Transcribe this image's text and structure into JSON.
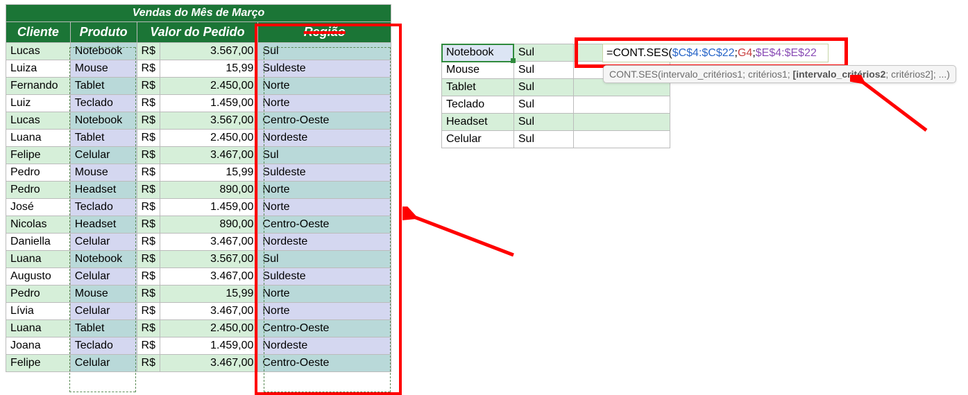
{
  "title": "Vendas do Mês de Março",
  "headers": {
    "cliente": "Cliente",
    "produto": "Produto",
    "valor": "Valor do Pedido",
    "regiao": "Região"
  },
  "currency": "R$",
  "rows": [
    {
      "cliente": "Lucas",
      "produto": "Notebook",
      "valor": "3.567,00",
      "regiao": "Sul"
    },
    {
      "cliente": "Luiza",
      "produto": "Mouse",
      "valor": "15,99",
      "regiao": "Suldeste"
    },
    {
      "cliente": "Fernando",
      "produto": "Tablet",
      "valor": "2.450,00",
      "regiao": "Norte"
    },
    {
      "cliente": "Luiz",
      "produto": "Teclado",
      "valor": "1.459,00",
      "regiao": "Norte"
    },
    {
      "cliente": "Lucas",
      "produto": "Notebook",
      "valor": "3.567,00",
      "regiao": "Centro-Oeste"
    },
    {
      "cliente": "Luana",
      "produto": "Tablet",
      "valor": "2.450,00",
      "regiao": "Nordeste"
    },
    {
      "cliente": "Felipe",
      "produto": "Celular",
      "valor": "3.467,00",
      "regiao": "Sul"
    },
    {
      "cliente": "Pedro",
      "produto": "Mouse",
      "valor": "15,99",
      "regiao": "Suldeste"
    },
    {
      "cliente": "Pedro",
      "produto": "Headset",
      "valor": "890,00",
      "regiao": "Norte"
    },
    {
      "cliente": "José",
      "produto": "Teclado",
      "valor": "1.459,00",
      "regiao": "Norte"
    },
    {
      "cliente": "Nicolas",
      "produto": "Headset",
      "valor": "890,00",
      "regiao": "Centro-Oeste"
    },
    {
      "cliente": "Daniella",
      "produto": "Celular",
      "valor": "3.467,00",
      "regiao": "Nordeste"
    },
    {
      "cliente": "Luana",
      "produto": "Notebook",
      "valor": "3.567,00",
      "regiao": "Sul"
    },
    {
      "cliente": "Augusto",
      "produto": "Celular",
      "valor": "3.467,00",
      "regiao": "Suldeste"
    },
    {
      "cliente": "Pedro",
      "produto": "Mouse",
      "valor": "15,99",
      "regiao": "Norte"
    },
    {
      "cliente": "Lívia",
      "produto": "Celular",
      "valor": "3.467,00",
      "regiao": "Norte"
    },
    {
      "cliente": "Luana",
      "produto": "Tablet",
      "valor": "2.450,00",
      "regiao": "Centro-Oeste"
    },
    {
      "cliente": "Joana",
      "produto": "Teclado",
      "valor": "1.459,00",
      "regiao": "Nordeste"
    },
    {
      "cliente": "Felipe",
      "produto": "Celular",
      "valor": "3.467,00",
      "regiao": "Centro-Oeste"
    }
  ],
  "side": [
    {
      "produto": "Notebook",
      "regiao": "Sul"
    },
    {
      "produto": "Mouse",
      "regiao": "Sul"
    },
    {
      "produto": "Tablet",
      "regiao": "Sul"
    },
    {
      "produto": "Teclado",
      "regiao": "Sul"
    },
    {
      "produto": "Headset",
      "regiao": "Sul"
    },
    {
      "produto": "Celular",
      "regiao": "Sul"
    }
  ],
  "formula": {
    "prefix": "=CONT.SES(",
    "range1": "$C$4:$C$22",
    "sep": ";",
    "crit1": "G4",
    "range2": "$E$4:$E$22",
    "full": "=CONT.SES($C$4:$C$22;G4;$E$4:$E$22"
  },
  "tooltip": {
    "fn": "CONT.SES",
    "args_plain1": "(intervalo_critérios1; critérios1; ",
    "args_bold": "[intervalo_critérios2",
    "args_plain2": "; critérios2]; ...)"
  }
}
